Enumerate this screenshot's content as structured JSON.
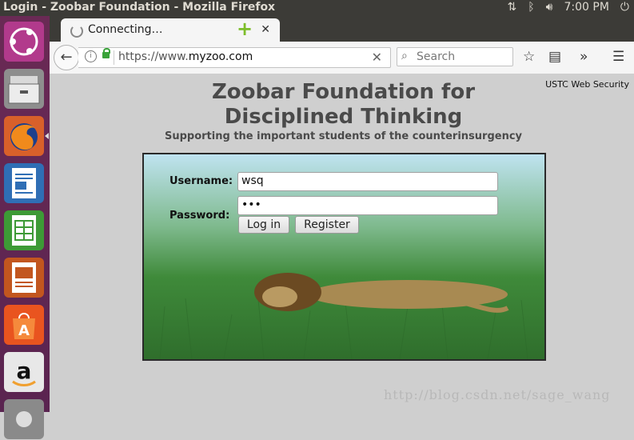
{
  "window": {
    "title": "Login - Zoobar Foundation - Mozilla Firefox"
  },
  "system": {
    "clock": "7:00 PM"
  },
  "browser": {
    "tab_label": "Connecting…",
    "url_scheme": "https://www.",
    "url_host": "myzoo.com",
    "search_placeholder": "Search"
  },
  "page": {
    "corner_label": "USTC Web Security",
    "title_line1": "Zoobar Foundation for",
    "title_line2": "Disciplined Thinking",
    "subtitle": "Supporting the important students of the counterinsurgency",
    "login": {
      "username_label": "Username:",
      "username_value": "wsq",
      "password_label": "Password:",
      "password_value": "•••",
      "login_button": "Log in",
      "register_button": "Register"
    }
  },
  "watermark": "http://blog.csdn.net/sage_wang",
  "launcher_items": [
    "ubuntu-dash-icon",
    "files-icon",
    "firefox-icon",
    "writer-icon",
    "calc-icon",
    "impress-icon",
    "software-center-icon",
    "amazon-icon",
    "settings-icon"
  ]
}
